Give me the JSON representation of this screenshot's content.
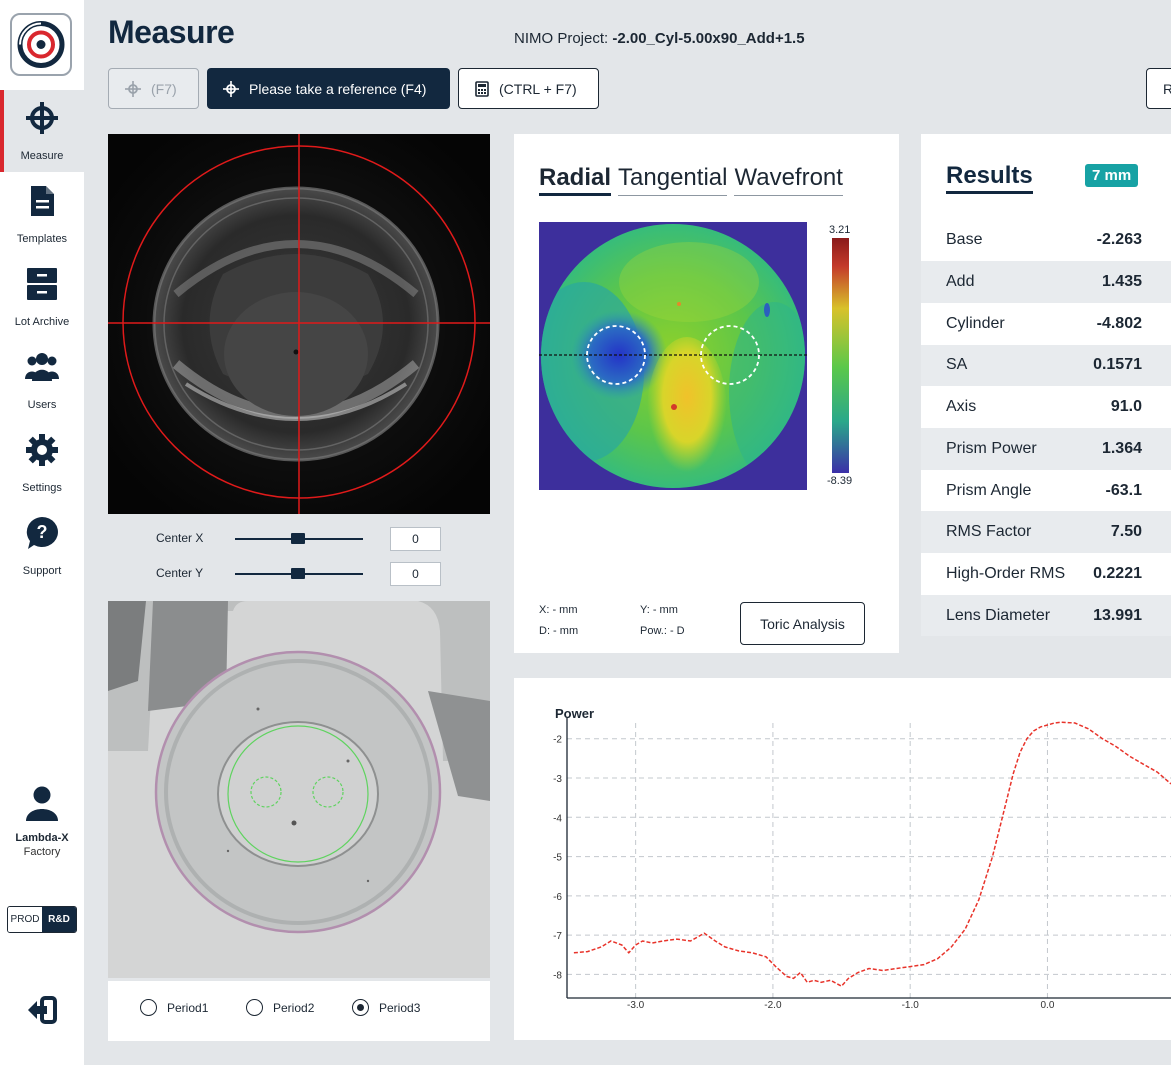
{
  "sidebar": {
    "logo_icon": "lambda-x-logo-icon",
    "items": [
      {
        "label": "Measure",
        "icon": "crosshair-icon",
        "active": true
      },
      {
        "label": "Templates",
        "icon": "document-icon"
      },
      {
        "label": "Lot Archive",
        "icon": "archive-icon"
      },
      {
        "label": "Users",
        "icon": "users-icon"
      },
      {
        "label": "Settings",
        "icon": "gear-icon"
      },
      {
        "label": "Support",
        "icon": "help-bubble-icon"
      }
    ],
    "user": {
      "name": "Lambda-X",
      "role": "Factory"
    },
    "env": {
      "prod": "PROD",
      "rd": "R&D",
      "active": "R&D"
    }
  },
  "header": {
    "title": "Measure",
    "project_label": "NIMO Project:",
    "project_value": "-2.00_Cyl-5.00x90_Add+1.5"
  },
  "toolbar": {
    "btn1": "(F7)",
    "btn2": "Please take a reference (F4)",
    "btn3": "(CTRL + F7)",
    "btn4": "R"
  },
  "camera": {
    "center_x_label": "Center X",
    "center_x_value": "0",
    "center_y_label": "Center Y",
    "center_y_value": "0"
  },
  "periods": {
    "options": [
      "Period1",
      "Period2",
      "Period3"
    ],
    "selected": "Period3"
  },
  "map": {
    "tabs": [
      "Radial",
      "Tangential",
      "Wavefront"
    ],
    "active_tab": "Radial",
    "scale_max": "3.21",
    "scale_min": "-8.39",
    "readout": {
      "x": "X: - mm",
      "y": "Y: - mm",
      "d": "D: - mm",
      "pow": "Pow.: - D"
    },
    "toric_button": "Toric Analysis"
  },
  "results": {
    "title": "Results",
    "badge": "7 mm",
    "rows": [
      {
        "label": "Base",
        "value": "-2.263"
      },
      {
        "label": "Add",
        "value": "1.435"
      },
      {
        "label": "Cylinder",
        "value": "-4.802"
      },
      {
        "label": "SA",
        "value": "0.1571"
      },
      {
        "label": "Axis",
        "value": "91.0"
      },
      {
        "label": "Prism Power",
        "value": "1.364"
      },
      {
        "label": "Prism Angle",
        "value": "-63.1"
      },
      {
        "label": "RMS Factor",
        "value": "7.50"
      },
      {
        "label": "High-Order RMS",
        "value": "0.2221"
      },
      {
        "label": "Lens Diameter",
        "value": "13.991"
      }
    ]
  },
  "chart_data": {
    "type": "line",
    "title": "",
    "ylabel": "Power",
    "xlabel": "",
    "xticks": [
      "-3.0",
      "-2.0",
      "-1.0",
      "0.0"
    ],
    "yticks": [
      "-2",
      "-3",
      "-4",
      "-5",
      "-6",
      "-7",
      "-8"
    ],
    "xlim": [
      -3.5,
      0.9
    ],
    "ylim": [
      -8.6,
      -1.6
    ],
    "grid": true,
    "series": [
      {
        "color": "#e8332a",
        "style": "dashed",
        "x": [
          -3.45,
          -3.35,
          -3.25,
          -3.18,
          -3.1,
          -3.05,
          -3.0,
          -2.95,
          -2.88,
          -2.8,
          -2.7,
          -2.6,
          -2.5,
          -2.42,
          -2.35,
          -2.25,
          -2.15,
          -2.05,
          -1.98,
          -1.9,
          -1.85,
          -1.8,
          -1.75,
          -1.7,
          -1.65,
          -1.58,
          -1.5,
          -1.45,
          -1.38,
          -1.3,
          -1.2,
          -1.1,
          -1.0,
          -0.9,
          -0.8,
          -0.7,
          -0.6,
          -0.5,
          -0.4,
          -0.3,
          -0.25,
          -0.2,
          -0.15,
          -0.1,
          -0.05,
          0.0,
          0.05,
          0.1,
          0.2,
          0.3,
          0.4,
          0.5,
          0.6,
          0.7,
          0.8,
          0.9
        ],
        "y": [
          -7.45,
          -7.42,
          -7.3,
          -7.15,
          -7.25,
          -7.45,
          -7.25,
          -7.15,
          -7.2,
          -7.15,
          -7.1,
          -7.15,
          -6.95,
          -7.15,
          -7.3,
          -7.4,
          -7.45,
          -7.55,
          -7.8,
          -8.05,
          -8.1,
          -7.95,
          -8.2,
          -8.15,
          -8.2,
          -8.15,
          -8.3,
          -8.1,
          -7.95,
          -7.85,
          -7.9,
          -7.85,
          -7.8,
          -7.75,
          -7.6,
          -7.3,
          -6.85,
          -6.1,
          -5.0,
          -3.6,
          -2.9,
          -2.35,
          -2.0,
          -1.8,
          -1.7,
          -1.65,
          -1.6,
          -1.58,
          -1.6,
          -1.75,
          -2.0,
          -2.2,
          -2.45,
          -2.65,
          -2.85,
          -3.15
        ]
      }
    ]
  }
}
